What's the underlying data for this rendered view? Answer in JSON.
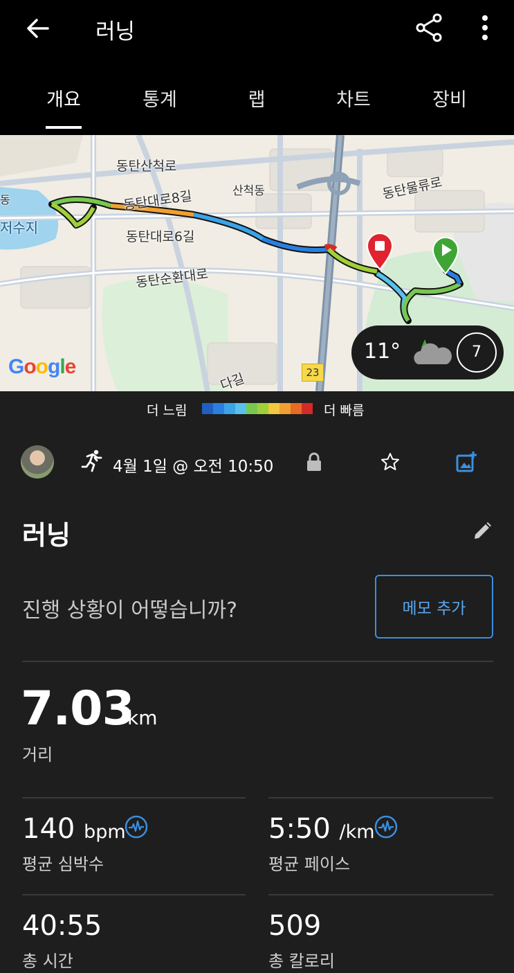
{
  "header": {
    "title": "러닝",
    "tabs": [
      "개요",
      "통계",
      "랩",
      "차트",
      "장비"
    ],
    "active_tab_index": 0
  },
  "map": {
    "labels": {
      "street_1": "동탄산척로",
      "street_2": "동탄대로8길",
      "street_3": "동탄대로6길",
      "street_4": "동탄순환대로",
      "street_5": "동탄물류로",
      "district": "산척동",
      "lake": "저수지",
      "left_edge": "동",
      "bottom_street": "다길"
    },
    "road_badge": "23",
    "weather": {
      "temperature": "11°",
      "wind": "7"
    },
    "provider": "Google"
  },
  "legend": {
    "slow_label": "더 느림",
    "fast_label": "더 빠름",
    "colors": [
      "#1f5fbf",
      "#2a7fe0",
      "#3ba3e8",
      "#59c0ec",
      "#78c850",
      "#a0cf3a",
      "#f2c840",
      "#f0a030",
      "#e86a24",
      "#d42a2a"
    ]
  },
  "meta": {
    "date_text": "4월 1일 @ 오전 10:50"
  },
  "activity": {
    "name": "러닝",
    "prompt": "진행 상황이 어떻습니까?",
    "memo_button": "메모 추가"
  },
  "stats": {
    "distance": {
      "value": "7.03",
      "unit": "km",
      "label": "거리"
    },
    "avg_hr": {
      "value": "140",
      "unit": "bpm",
      "label": "평균 심박수"
    },
    "avg_pace": {
      "value": "5:50",
      "unit": "/km",
      "label": "평균 페이스"
    },
    "total_time": {
      "value": "40:55",
      "label": "총 시간"
    },
    "calories": {
      "value": "509",
      "label": "총 칼로리"
    }
  },
  "colors": {
    "accent_blue": "#3b8fe0",
    "header_bg": "#000000",
    "page_bg": "#1e1e1e"
  }
}
